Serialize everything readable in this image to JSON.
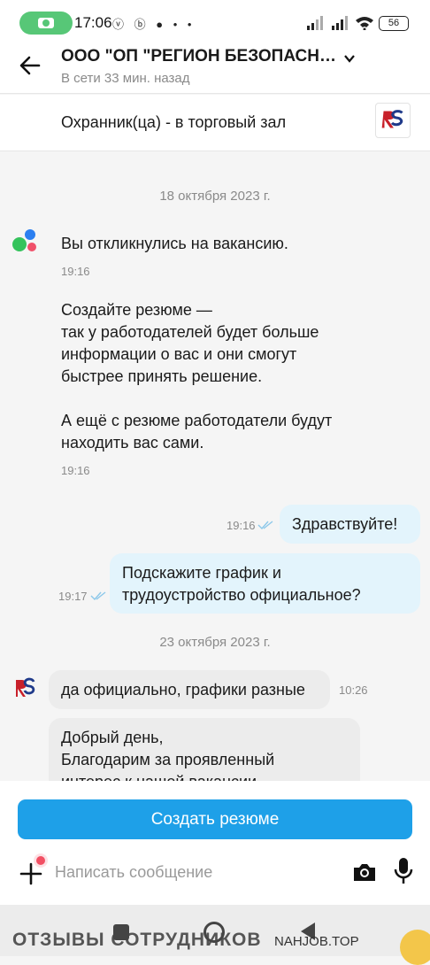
{
  "status": {
    "time": "17:06",
    "battery": "56"
  },
  "header": {
    "title": "ООО \"ОП \"РЕГИОН БЕЗОПАСН…",
    "subtitle": "В сети 33 мин. назад"
  },
  "vacancy": {
    "title": "Охранник(ца) - в торговый зал"
  },
  "chat": {
    "date1": "18 октября 2023 г.",
    "sys1": {
      "text": "Вы откликнулись на вакансию.",
      "time": "19:16"
    },
    "sys2": {
      "text": "Создайте резюме —\nтак у работодателей будет больше\nинформации о вас и они смогут\nбыстрее принять решение.\n\nА ещё с резюме работодатели будут\nнаходить вас сами.",
      "time": "19:16"
    },
    "out1": {
      "text": "Здравствуйте!",
      "time": "19:16"
    },
    "out2": {
      "text": "Подскажите график и\nтрудоустройство официальное?",
      "time": "19:17"
    },
    "date2": "23 октября 2023 г.",
    "in1": {
      "text": "да официально, графики разные",
      "time": "10:26"
    },
    "in2": {
      "text": "Добрый день,\nБлагодарим за проявленный\nинтерес к нашей вакансии"
    }
  },
  "composer": {
    "cta_label": "Создать резюме",
    "placeholder": "Написать сообщение"
  },
  "watermark": {
    "left": "ОТЗЫВЫ СОТРУДНИКОВ",
    "right": "NAHJOB.TOP"
  },
  "colors": {
    "accent": "#1ea0e8",
    "outgoing_bubble": "#e3f4fc",
    "incoming_bubble": "#ececec",
    "badge": "#f24f63"
  }
}
